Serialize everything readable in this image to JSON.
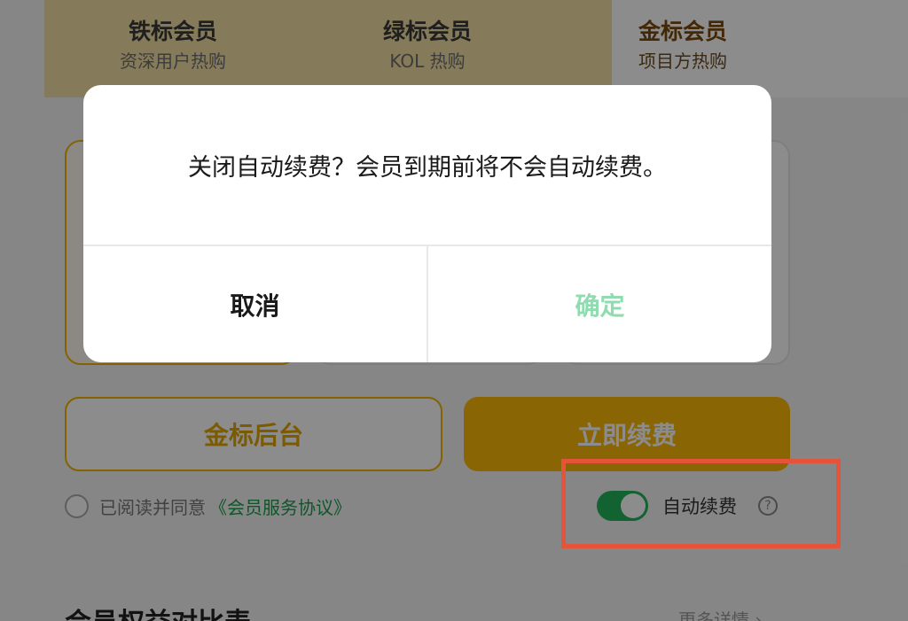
{
  "tabs": [
    {
      "name": "铁标会员",
      "sub": "资深用户热购"
    },
    {
      "name": "绿标会员",
      "sub": "KOL 热购"
    },
    {
      "name": "金标会员",
      "sub": "项目方热购"
    }
  ],
  "actions": {
    "admin_label": "金标后台",
    "renew_label": "立即续费"
  },
  "agreement": {
    "text": "已阅读并同意",
    "link": "《会员服务协议》",
    "checked": false
  },
  "auto_renew": {
    "label": "自动续费",
    "help": "?",
    "enabled": true
  },
  "compare": {
    "title": "会员权益对比表",
    "more": "更多详情 ›"
  },
  "dialog": {
    "message": "关闭自动续费？会员到期前将不会自动续费。",
    "cancel_label": "取消",
    "confirm_label": "确定"
  },
  "colors": {
    "gold": "#f0b200",
    "green": "#23b35a",
    "confirm_text": "#8fdcb0",
    "highlight": "#e5533a"
  }
}
